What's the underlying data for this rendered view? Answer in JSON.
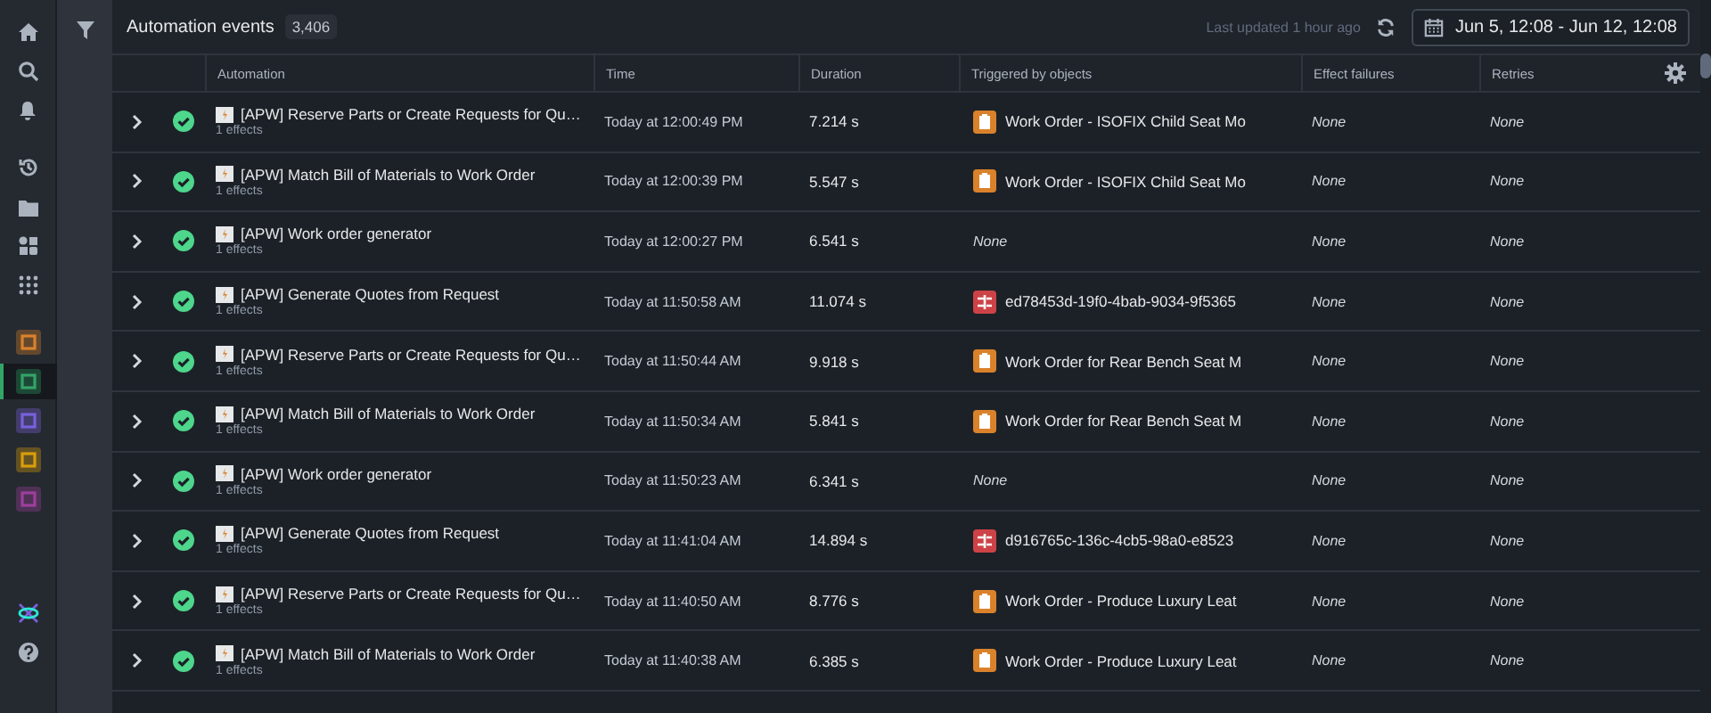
{
  "sidebar": {
    "sections": [
      {
        "items": [
          {
            "kind": "home",
            "selected": false
          },
          {
            "kind": "search",
            "selected": false
          },
          {
            "kind": "bell",
            "selected": false
          }
        ]
      },
      {
        "items": [
          {
            "kind": "history",
            "selected": false
          },
          {
            "kind": "folder",
            "selected": false
          },
          {
            "kind": "objects",
            "selected": false
          },
          {
            "kind": "grid",
            "selected": false
          }
        ]
      },
      {
        "items": [
          {
            "kind": "app-orange",
            "selected": false
          },
          {
            "kind": "app-green",
            "selected": true
          },
          {
            "kind": "app-search",
            "selected": false
          },
          {
            "kind": "app-funnel",
            "selected": false
          },
          {
            "kind": "app-chart",
            "selected": false
          }
        ]
      }
    ],
    "bottom_items": [
      {
        "kind": "molecule"
      },
      {
        "kind": "help"
      }
    ]
  },
  "header": {
    "title": "Automation events",
    "count": "3,406",
    "last_updated": "Last updated 1 hour ago",
    "date_range": "Jun 5, 12:08 - Jun 12, 12:08"
  },
  "table": {
    "columns": [
      "Automation",
      "Time",
      "Duration",
      "Triggered by objects",
      "Effect failures",
      "Retries"
    ],
    "rows": [
      {
        "success": true,
        "automation": "[APW] Reserve Parts or Create Requests for Qu…",
        "effects": "1 effects",
        "time": "Today at 12:00:49 PM",
        "duration": "7.214 s",
        "trigger": {
          "kind": "work-order",
          "text": "Work Order - ISOFIX Child Seat Mo"
        },
        "effect_failures": "None",
        "retries": "None"
      },
      {
        "success": true,
        "automation": "[APW] Match Bill of Materials to Work Order",
        "effects": "1 effects",
        "time": "Today at 12:00:39 PM",
        "duration": "5.547 s",
        "trigger": {
          "kind": "work-order",
          "text": "Work Order - ISOFIX Child Seat Mo"
        },
        "effect_failures": "None",
        "retries": "None"
      },
      {
        "success": true,
        "automation": "[APW] Work order generator",
        "effects": "1 effects",
        "time": "Today at 12:00:27 PM",
        "duration": "6.541 s",
        "trigger": {
          "kind": "none",
          "text": "None"
        },
        "effect_failures": "None",
        "retries": "None"
      },
      {
        "success": true,
        "automation": "[APW] Generate Quotes from Request",
        "effects": "1 effects",
        "time": "Today at 11:50:58 AM",
        "duration": "11.074 s",
        "trigger": {
          "kind": "request",
          "text": "ed78453d-19f0-4bab-9034-9f5365"
        },
        "effect_failures": "None",
        "retries": "None"
      },
      {
        "success": true,
        "automation": "[APW] Reserve Parts or Create Requests for Qu…",
        "effects": "1 effects",
        "time": "Today at 11:50:44 AM",
        "duration": "9.918 s",
        "trigger": {
          "kind": "work-order",
          "text": "Work Order for Rear Bench Seat M"
        },
        "effect_failures": "None",
        "retries": "None"
      },
      {
        "success": true,
        "automation": "[APW] Match Bill of Materials to Work Order",
        "effects": "1 effects",
        "time": "Today at 11:50:34 AM",
        "duration": "5.841 s",
        "trigger": {
          "kind": "work-order",
          "text": "Work Order for Rear Bench Seat M"
        },
        "effect_failures": "None",
        "retries": "None"
      },
      {
        "success": true,
        "automation": "[APW] Work order generator",
        "effects": "1 effects",
        "time": "Today at 11:50:23 AM",
        "duration": "6.341 s",
        "trigger": {
          "kind": "none",
          "text": "None"
        },
        "effect_failures": "None",
        "retries": "None"
      },
      {
        "success": true,
        "automation": "[APW] Generate Quotes from Request",
        "effects": "1 effects",
        "time": "Today at 11:41:04 AM",
        "duration": "14.894 s",
        "trigger": {
          "kind": "request",
          "text": "d916765c-136c-4cb5-98a0-e8523"
        },
        "effect_failures": "None",
        "retries": "None"
      },
      {
        "success": true,
        "automation": "[APW] Reserve Parts or Create Requests for Qu…",
        "effects": "1 effects",
        "time": "Today at 11:40:50 AM",
        "duration": "8.776 s",
        "trigger": {
          "kind": "work-order",
          "text": "Work Order - Produce Luxury Leat"
        },
        "effect_failures": "None",
        "retries": "None"
      },
      {
        "success": true,
        "automation": "[APW] Match Bill of Materials to Work Order",
        "effects": "1 effects",
        "time": "Today at 11:40:38 AM",
        "duration": "6.385 s",
        "trigger": {
          "kind": "work-order",
          "text": "Work Order - Produce Luxury Leat"
        },
        "effect_failures": "None",
        "retries": "None"
      }
    ]
  }
}
